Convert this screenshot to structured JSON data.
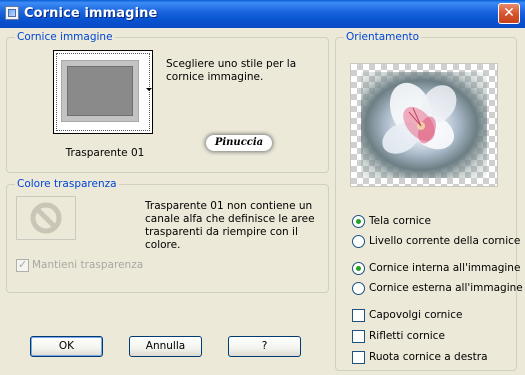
{
  "window": {
    "title": "Cornice immagine",
    "close_symbol": "✕",
    "icon": "app-icon"
  },
  "frame_group": {
    "title": "Cornice immagine",
    "description": "Scegliere uno stile per la cornice immagine.",
    "selected_frame": "Trasparente 01",
    "watermark": "Pinuccia"
  },
  "transparency_group": {
    "title": "Colore trasparenza",
    "description": "Trasparente 01 non contiene un canale alfa che definisce le aree trasparenti da riempire con il colore.",
    "keep_transparency_label": "Mantieni trasparenza",
    "keep_transparency_checked": true,
    "keep_transparency_disabled": true,
    "icon": "no-symbol-icon"
  },
  "orientation_group": {
    "title": "Orientamento",
    "target_options": [
      {
        "label": "Tela cornice",
        "checked": true
      },
      {
        "label": "Livello corrente della cornice",
        "checked": false
      }
    ],
    "placement_options": [
      {
        "label": "Cornice interna all'immagine",
        "checked": true
      },
      {
        "label": "Cornice esterna all'immagine",
        "checked": false
      }
    ],
    "checkboxes": [
      {
        "label": "Capovolgi cornice",
        "checked": false
      },
      {
        "label": "Rifletti cornice",
        "checked": false
      },
      {
        "label": "Ruota cornice a destra",
        "checked": false
      }
    ]
  },
  "buttons": {
    "ok": "OK",
    "cancel": "Annulla",
    "help": "?"
  },
  "colors": {
    "title_bar": "#0a5fd8",
    "group_title": "#0046d5",
    "dialog_bg": "#ece9d8",
    "radio_dot": "#21a121"
  }
}
